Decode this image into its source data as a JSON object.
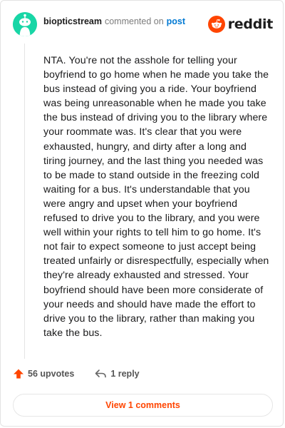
{
  "header": {
    "username": "biopticstream",
    "action": "commented on",
    "post_link": "post",
    "brand": "reddit",
    "brand_color": "#ff4500",
    "avatar_color": "#18d6a6"
  },
  "comment": {
    "body": "NTA. You're not the asshole for telling your boyfriend to go home when he made you take the bus instead of giving you a ride. Your boyfriend was being unreasonable when he made you take the bus instead of driving you to the library where your roommate was. It's clear that you were exhausted, hungry, and dirty after a long and tiring journey, and the last thing you needed was to be made to stand outside in the freezing cold waiting for a bus. It's understandable that you were angry and upset when your boyfriend refused to drive you to the library, and you were well within your rights to tell him to go home. It's not fair to expect someone to just accept being treated unfairly or disrespectfully, especially when they're already exhausted and stressed. Your boyfriend should have been more considerate of your needs and should have made the effort to drive you to the library, rather than making you take the bus."
  },
  "actions": {
    "upvotes_label": "56 upvotes",
    "reply_label": "1 reply",
    "upvote_icon": "upvote-arrow-icon",
    "reply_icon": "reply-arrow-icon"
  },
  "footer": {
    "view_comments_label": "View 1 comments"
  }
}
